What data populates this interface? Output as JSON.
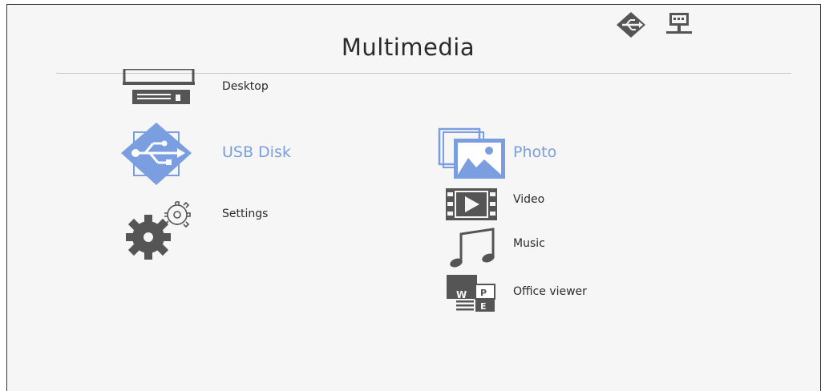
{
  "header": {
    "title": "Multimedia"
  },
  "status": {
    "usb_icon": "usb-diamond-icon",
    "network_icon": "network-computer-icon"
  },
  "sources": {
    "desktop": "Desktop",
    "usb_disk": "USB Disk",
    "settings": "Settings"
  },
  "media": {
    "photo": "Photo",
    "video": "Video",
    "music": "Music",
    "office_viewer": "Office viewer"
  },
  "office_icon_letters": {
    "w": "W",
    "p": "P",
    "e": "E"
  },
  "colors": {
    "accent": "#7a9ee0",
    "icon_gray": "#5a5a5a"
  }
}
